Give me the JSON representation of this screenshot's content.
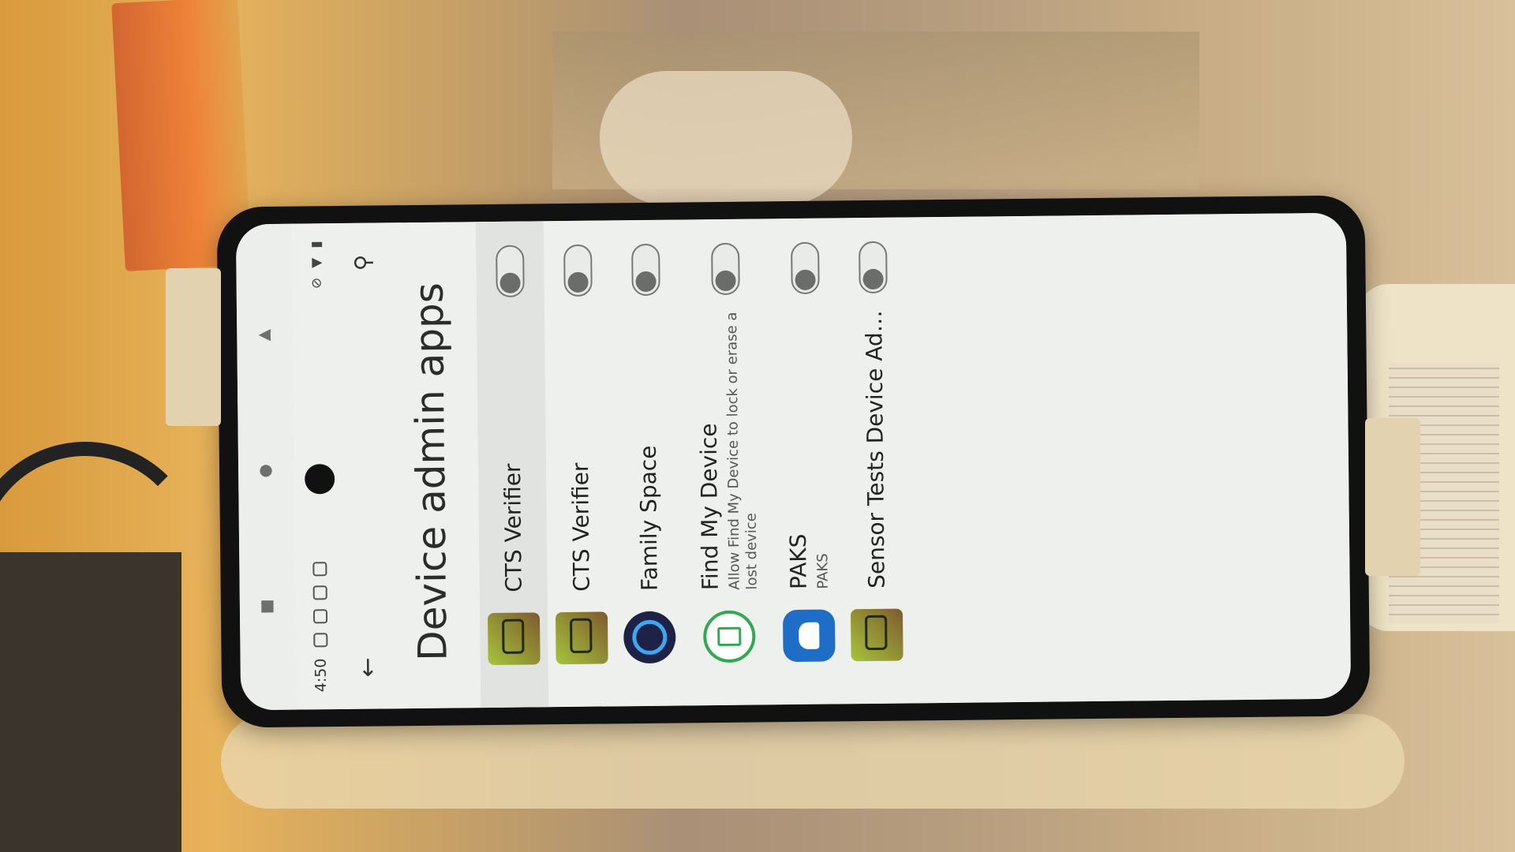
{
  "status_bar": {
    "time": "4:50",
    "icons": [
      "mode-icon",
      "notification-icon",
      "sim-icon",
      "nfc-icon"
    ],
    "right_icons": [
      "mute-icon",
      "wifi-icon",
      "battery-icon"
    ]
  },
  "top_bar": {
    "back_icon": "arrow-left-icon",
    "search_icon": "search-icon"
  },
  "page": {
    "title": "Device admin apps"
  },
  "apps": [
    {
      "name": "CTS Verifier",
      "subtitle": "",
      "icon": "cts-verifier-icon",
      "enabled": false,
      "highlighted": true
    },
    {
      "name": "CTS Verifier",
      "subtitle": "",
      "icon": "cts-verifier-icon",
      "enabled": false,
      "highlighted": false
    },
    {
      "name": "Family Space",
      "subtitle": "",
      "icon": "family-space-icon",
      "enabled": false,
      "highlighted": false
    },
    {
      "name": "Find My Device",
      "subtitle": "Allow Find My Device to lock or erase a lost device",
      "icon": "find-my-device-icon",
      "enabled": false,
      "highlighted": false
    },
    {
      "name": "PAKS",
      "subtitle": "PAKS",
      "icon": "paks-icon",
      "enabled": false,
      "highlighted": false
    },
    {
      "name": "Sensor Tests Device Admi..",
      "subtitle": "",
      "icon": "cts-verifier-icon",
      "enabled": false,
      "highlighted": false
    }
  ],
  "nav_bar": {
    "buttons": [
      "back-triangle-icon",
      "home-circle-icon",
      "recents-square-icon"
    ]
  },
  "colors": {
    "screen_bg": "#eef0ee",
    "text_primary": "#222222",
    "switch_off": "#6a6d6a"
  }
}
